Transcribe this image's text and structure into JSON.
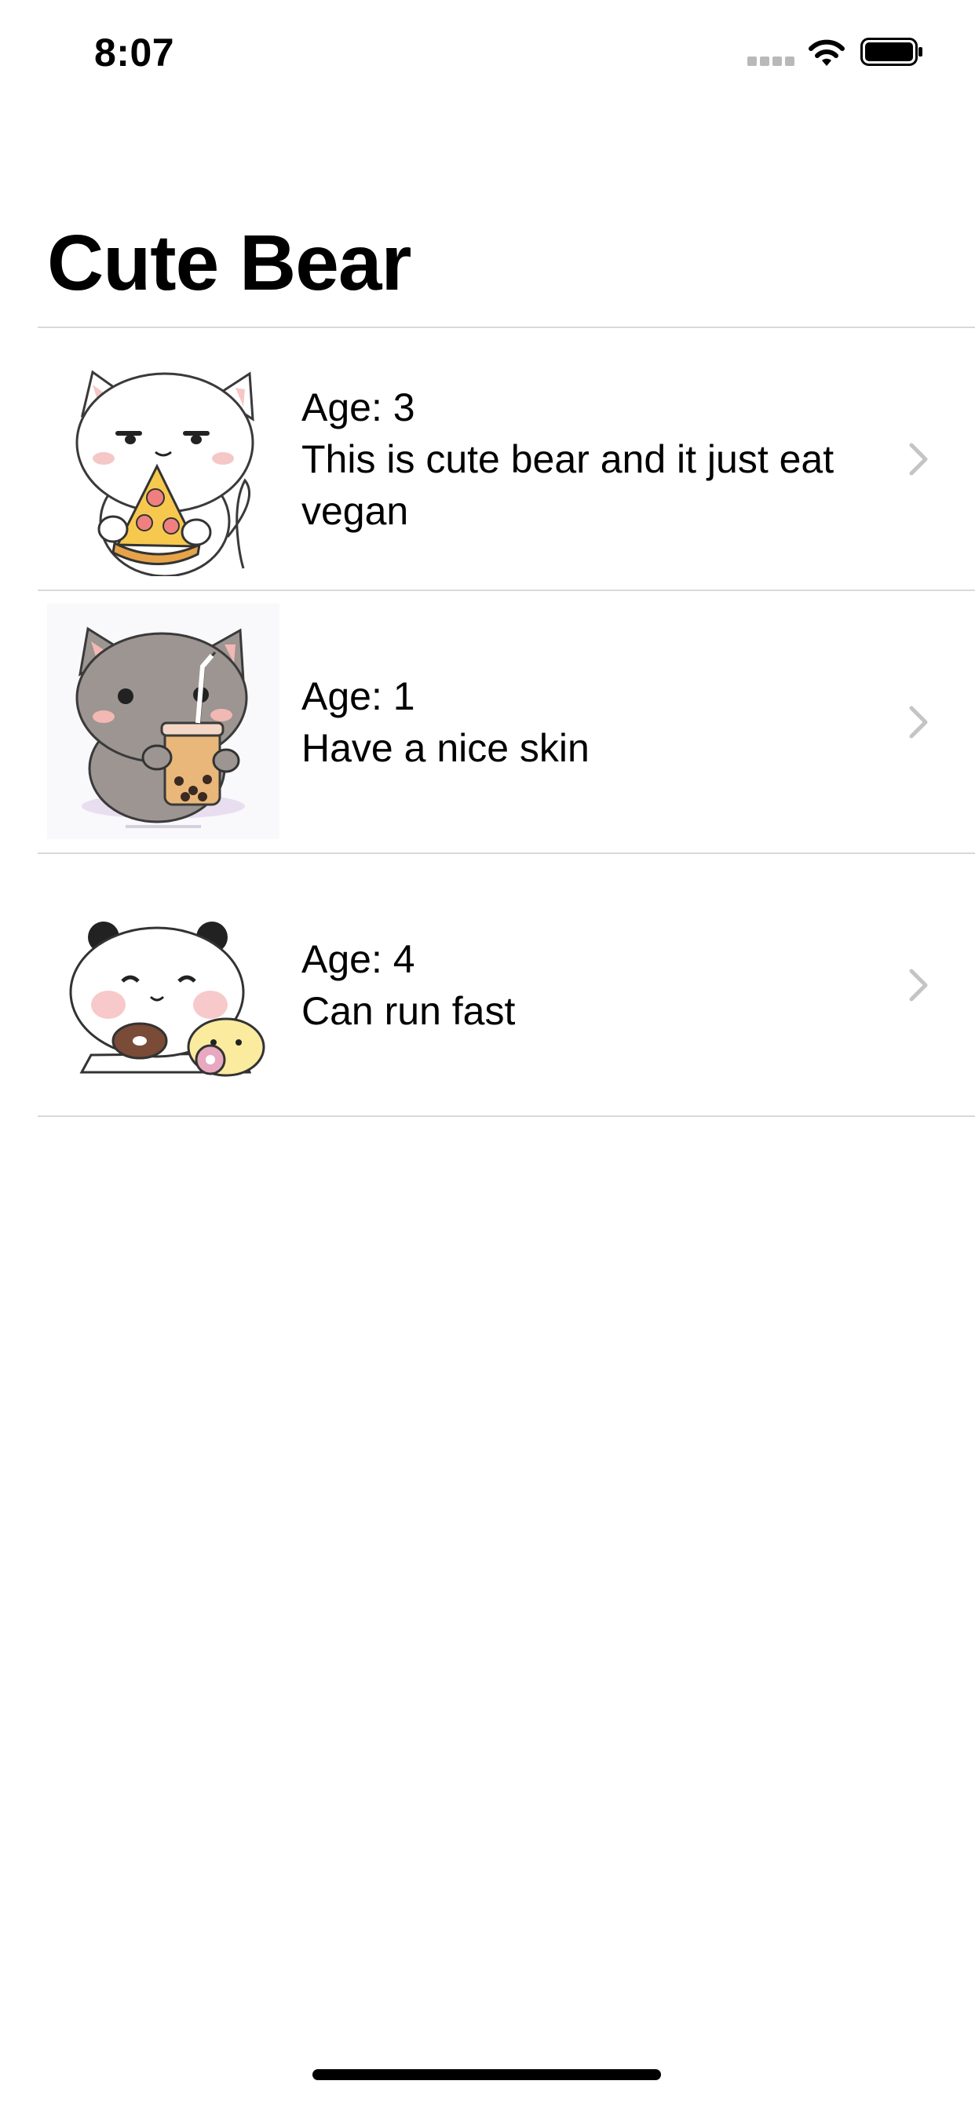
{
  "status_bar": {
    "time": "8:07",
    "icons": [
      "cellular-signal-icon",
      "wifi-icon",
      "battery-icon"
    ]
  },
  "page": {
    "title": "Cute Bear"
  },
  "list": {
    "items": [
      {
        "age_text": "Age: 3",
        "description": "This is cute bear and it just eat vegan",
        "thumbnail": "cat-eating-pizza-sticker",
        "accessory": "chevron-right-icon"
      },
      {
        "age_text": "Age: 1",
        "description": "Have a nice skin",
        "thumbnail": "cat-drinking-bubble-tea-sticker",
        "accessory": "chevron-right-icon"
      },
      {
        "age_text": "Age: 4",
        "description": "Can run fast",
        "thumbnail": "panda-eating-donuts-sticker",
        "accessory": "chevron-right-icon"
      }
    ]
  },
  "colors": {
    "background": "#ffffff",
    "text": "#000000",
    "separator": "#d9d9dc",
    "chevron": "#c4c4c7"
  }
}
